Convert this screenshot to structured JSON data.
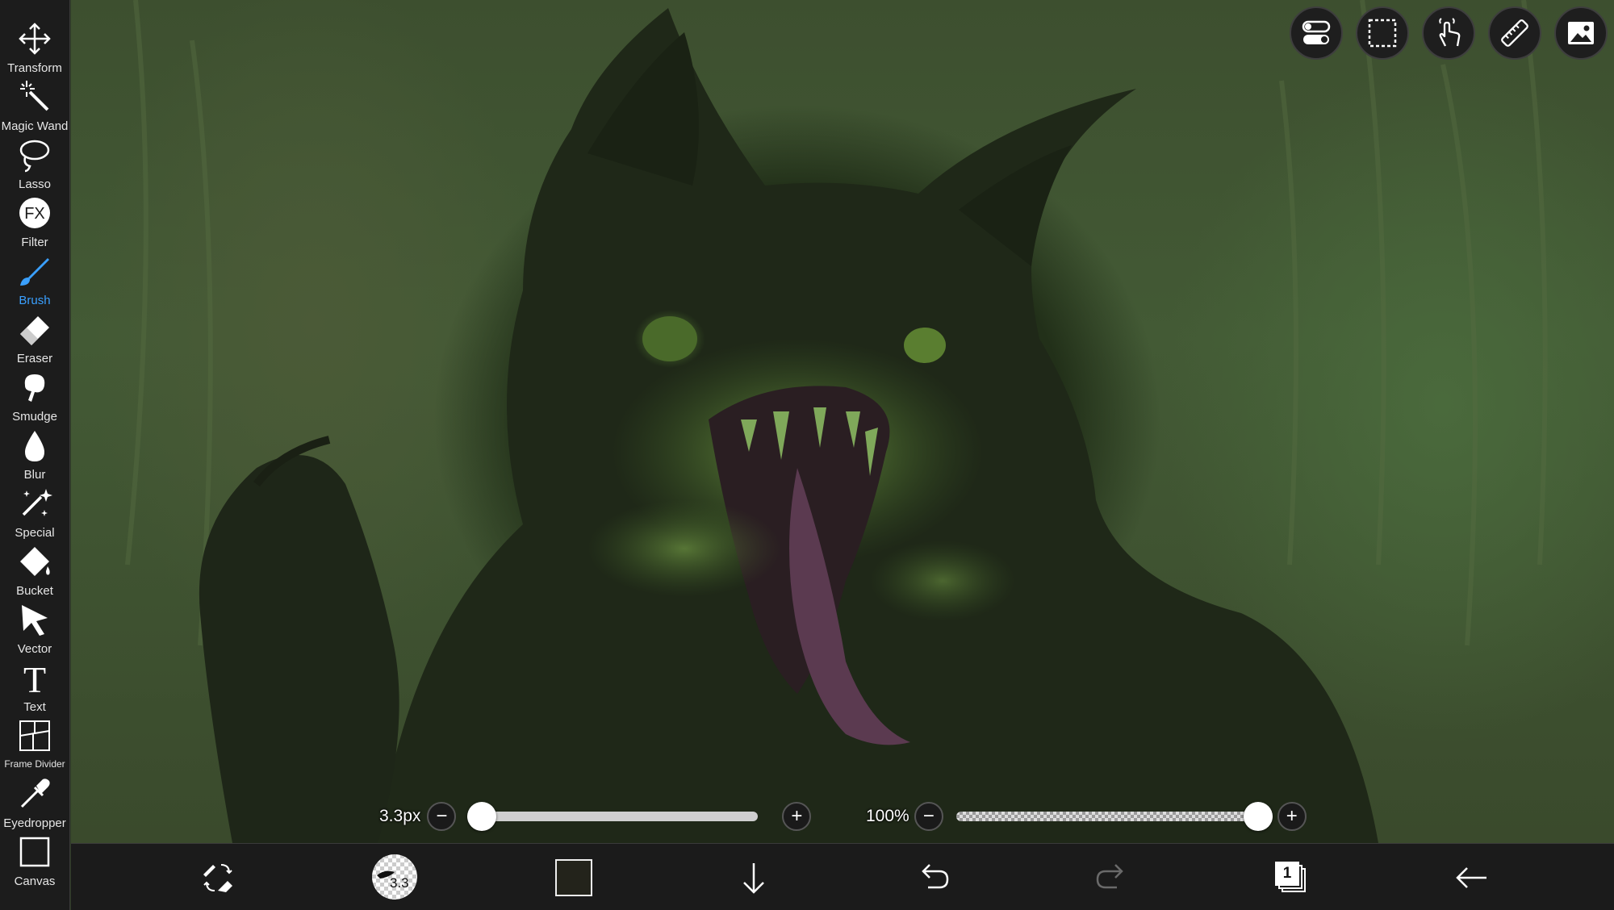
{
  "tools": [
    {
      "id": "transform",
      "label": "Transform",
      "icon": "move-arrows-icon"
    },
    {
      "id": "magic-wand",
      "label": "Magic Wand",
      "icon": "magic-wand-icon"
    },
    {
      "id": "lasso",
      "label": "Lasso",
      "icon": "lasso-icon"
    },
    {
      "id": "filter",
      "label": "Filter",
      "icon": "fx-icon",
      "glyph": "FX"
    },
    {
      "id": "brush",
      "label": "Brush",
      "icon": "brush-icon",
      "active": true
    },
    {
      "id": "eraser",
      "label": "Eraser",
      "icon": "eraser-icon"
    },
    {
      "id": "smudge",
      "label": "Smudge",
      "icon": "smudge-icon"
    },
    {
      "id": "blur",
      "label": "Blur",
      "icon": "droplet-icon"
    },
    {
      "id": "special",
      "label": "Special",
      "icon": "sparkle-pen-icon"
    },
    {
      "id": "bucket",
      "label": "Bucket",
      "icon": "bucket-icon"
    },
    {
      "id": "vector",
      "label": "Vector",
      "icon": "cursor-arrow-icon"
    },
    {
      "id": "text",
      "label": "Text",
      "icon": "text-icon",
      "glyph": "T"
    },
    {
      "id": "frame-divider",
      "label": "Frame Divider",
      "icon": "frame-divider-icon"
    },
    {
      "id": "eyedropper",
      "label": "Eyedropper",
      "icon": "eyedropper-icon"
    },
    {
      "id": "canvas",
      "label": "Canvas",
      "icon": "canvas-square-icon"
    }
  ],
  "top_buttons": [
    {
      "id": "toggle",
      "icon": "toggle-switches-icon"
    },
    {
      "id": "selection",
      "icon": "dashed-selection-icon"
    },
    {
      "id": "hand",
      "icon": "touch-hand-icon"
    },
    {
      "id": "ruler",
      "icon": "ruler-icon"
    },
    {
      "id": "image",
      "icon": "image-reference-icon"
    }
  ],
  "brush_size": {
    "value_text": "3.3px",
    "minus": "−",
    "plus": "+",
    "level": 0.0
  },
  "opacity": {
    "value_text": "100%",
    "minus": "−",
    "plus": "+",
    "level": 1.0
  },
  "bottom_bar": {
    "brush_preview_size": "3.3",
    "color_swatch": "#23231b",
    "layers_count": "1",
    "icons": [
      "brush-eraser-swap-icon",
      "brush-preview-icon",
      "color-swatch",
      "arrow-down-icon",
      "undo-icon",
      "redo-icon",
      "layers-icon",
      "back-arrow-icon"
    ]
  },
  "colors": {
    "accent": "#3aa0ff",
    "toolbar_bg": "#1c1c1c"
  }
}
